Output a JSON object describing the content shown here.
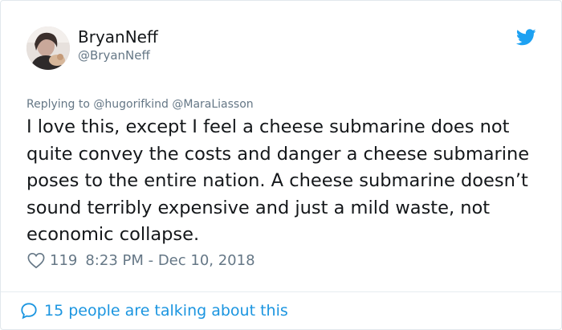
{
  "user": {
    "display_name": "BryanNeff",
    "handle": "@BryanNeff"
  },
  "reply": {
    "prefix": "Replying to",
    "mentions": "@hugorifkind @MaraLiasson"
  },
  "tweet": {
    "text": "I love this, except I feel a cheese submarine does not quite convey the costs and danger a cheese submarine poses to the entire nation. A cheese submarine doesn’t sound terribly expensive and just a mild waste, not economic collapse.",
    "likes": "119",
    "timestamp": "8:23 PM - Dec 10, 2018"
  },
  "footer": {
    "talking_text": "15 people are talking about this"
  },
  "icons": {
    "brand": "twitter-bird-icon",
    "like": "heart-icon",
    "conversation": "speech-bubble-icon"
  },
  "colors": {
    "brand_blue": "#1da1f2",
    "link_blue": "#1b95e0",
    "muted_gray": "#657786",
    "text": "#14171a"
  }
}
